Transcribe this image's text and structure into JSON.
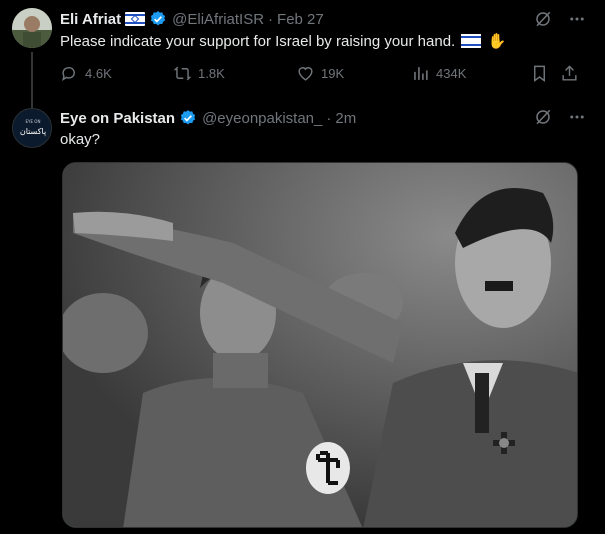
{
  "tweets": [
    {
      "name": "Eli Afriat",
      "handle": "@EliAfriatISR",
      "separator": "·",
      "time": "Feb 27",
      "text": "Please indicate your support for Israel by raising your hand.",
      "emoji_hand": "✋",
      "actions": {
        "replies": "4.6K",
        "retweets": "1.8K",
        "likes": "19K",
        "views": "434K"
      }
    },
    {
      "name": "Eye on Pakistan",
      "handle": "@eyeonpakistan_",
      "separator": "·",
      "time": "2m",
      "text": "okay?",
      "avatar_text": "پاکستان",
      "avatar_small_text": "EYE ON"
    }
  ],
  "icons": {
    "verified": "verified-badge-icon",
    "grok": "grok-icon",
    "more": "more-icon",
    "reply": "reply-icon",
    "retweet": "retweet-icon",
    "like": "heart-icon",
    "views": "views-icon",
    "bookmark": "bookmark-icon",
    "share": "share-icon"
  },
  "colors": {
    "background": "#000000",
    "text": "#e7e9ea",
    "secondary": "#71767b",
    "verified": "#1d9bf0",
    "border": "#2f3336"
  }
}
